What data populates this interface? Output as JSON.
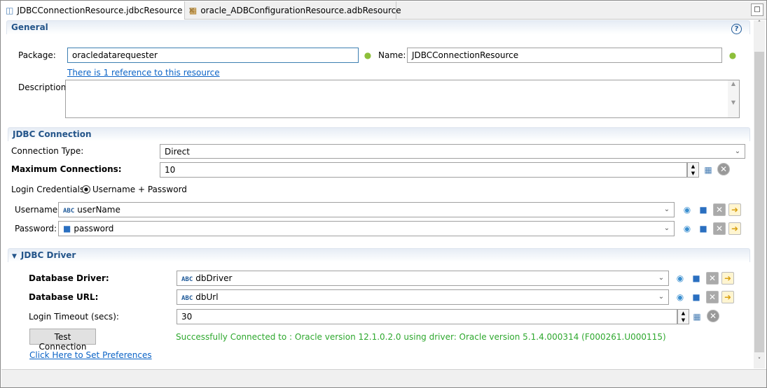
{
  "tabs": [
    {
      "label": "JDBCConnectionResource.jdbcResource",
      "active": true
    },
    {
      "label": "oracle_ADBConfigurationResource.adbResource",
      "active": false
    }
  ],
  "general": {
    "title": "General",
    "package_label": "Package:",
    "package_value": "oracledatarequester",
    "name_label": "Name:",
    "name_value": "JDBCConnectionResource",
    "reference_link": "There is 1 reference to this resource",
    "description_label": "Description:",
    "description_value": ""
  },
  "jdbc_connection": {
    "title": "JDBC Connection",
    "connection_type_label": "Connection Type:",
    "connection_type_value": "Direct",
    "max_connections_label": "Maximum Connections:",
    "max_connections_value": "10",
    "login_credentials_label": "Login Credentials:",
    "login_credentials_option": "Username + Password",
    "username_label": "Username:",
    "username_value": "userName",
    "password_label": "Password:",
    "password_value": "password"
  },
  "jdbc_driver": {
    "title": "JDBC Driver",
    "driver_label": "Database Driver:",
    "driver_value": "dbDriver",
    "url_label": "Database URL:",
    "url_value": "dbUrl",
    "timeout_label": "Login Timeout (secs):",
    "timeout_value": "30",
    "test_button": "Test Connection",
    "status": "Successfully Connected to : Oracle version 12.1.0.2.0 using driver: Oracle version 5.1.4.000314 (F000261.U000115)",
    "preferences_link": "Click Here to Set Preferences"
  },
  "colors": {
    "success": "#2ea82e",
    "link": "#0b63c6",
    "header": "#24558a"
  },
  "icons": {
    "abc": "ABC"
  }
}
